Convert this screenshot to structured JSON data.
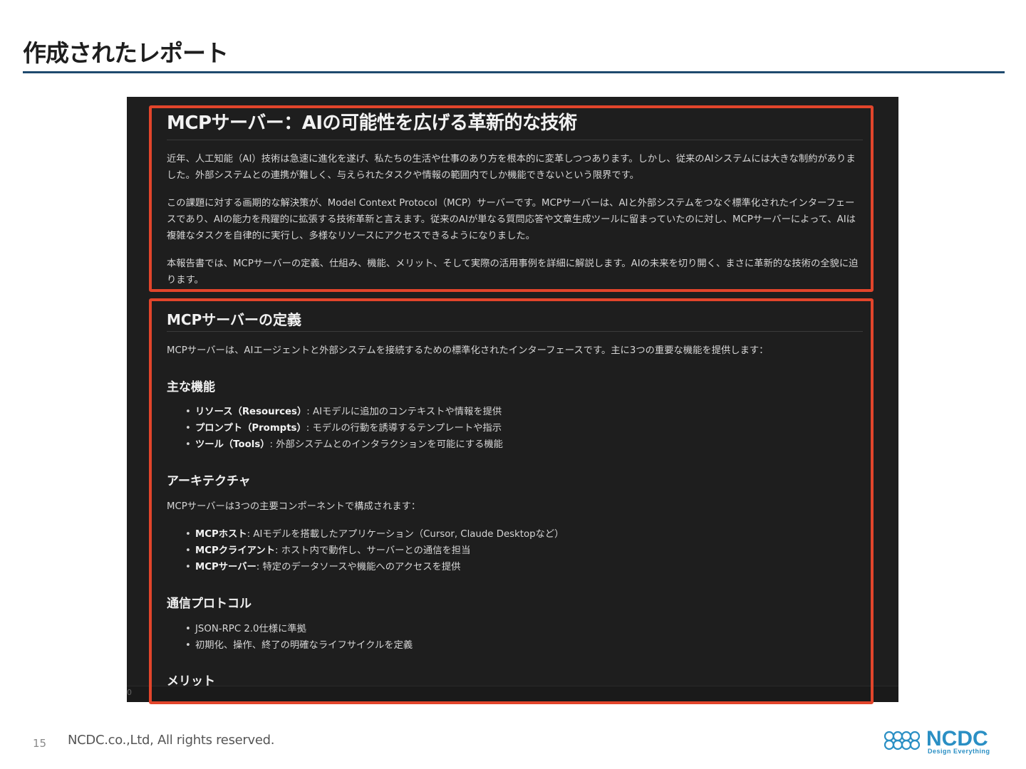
{
  "slide": {
    "title": "作成されたレポート",
    "page_number": "15",
    "copyright": "NCDC.co.,Ltd, All rights reserved."
  },
  "logo": {
    "name": "NCDC",
    "tagline": "Design Everything",
    "color": "#2a8fc4"
  },
  "screenshot": {
    "h1": "MCPサーバー：AIの可能性を広げる革新的な技術",
    "intro_paragraphs": [
      "近年、人工知能（AI）技術は急速に進化を遂げ、私たちの生活や仕事のあり方を根本的に変革しつつあります。しかし、従来のAIシステムには大きな制約がありました。外部システムとの連携が難しく、与えられたタスクや情報の範囲内でしか機能できないという限界です。",
      "この課題に対する画期的な解決策が、Model Context Protocol（MCP）サーバーです。MCPサーバーは、AIと外部システムをつなぐ標準化されたインターフェースであり、AIの能力を飛躍的に拡張する技術革新と言えます。従来のAIが単なる質問応答や文章生成ツールに留まっていたのに対し、MCPサーバーによって、AIは複雑なタスクを自律的に実行し、多様なリソースにアクセスできるようになりました。",
      "本報告書では、MCPサーバーの定義、仕組み、機能、メリット、そして実際の活用事例を詳細に解説します。AIの未来を切り開く、まさに革新的な技術の全貌に迫ります。"
    ],
    "h2": "MCPサーバーの定義",
    "definition": "MCPサーバーは、AIエージェントと外部システムを接続するための標準化されたインターフェースです。主に3つの重要な機能を提供します：",
    "features_heading": "主な機能",
    "features": [
      {
        "term": "リソース（Resources）",
        "desc": ": AIモデルに追加のコンテキストや情報を提供"
      },
      {
        "term": "プロンプト（Prompts）",
        "desc": ": モデルの行動を誘導するテンプレートや指示"
      },
      {
        "term": "ツール（Tools）",
        "desc": ": 外部システムとのインタラクションを可能にする機能"
      }
    ],
    "arch_heading": "アーキテクチャ",
    "arch_intro": "MCPサーバーは3つの主要コンポーネントで構成されます：",
    "arch_items": [
      {
        "term": "MCPホスト",
        "desc": ": AIモデルを搭載したアプリケーション（Cursor, Claude Desktopなど）"
      },
      {
        "term": "MCPクライアント",
        "desc": ": ホスト内で動作し、サーバーとの通信を担当"
      },
      {
        "term": "MCPサーバー",
        "desc": ": 特定のデータソースや機能へのアクセスを提供"
      }
    ],
    "protocol_heading": "通信プロトコル",
    "protocol_items": [
      "JSON-RPC 2.0仕様に準拠",
      "初期化、操作、終了の明確なライフサイクルを定義"
    ],
    "merit_heading": "メリット",
    "status_text": "0"
  },
  "highlight_color": "#e2452b"
}
